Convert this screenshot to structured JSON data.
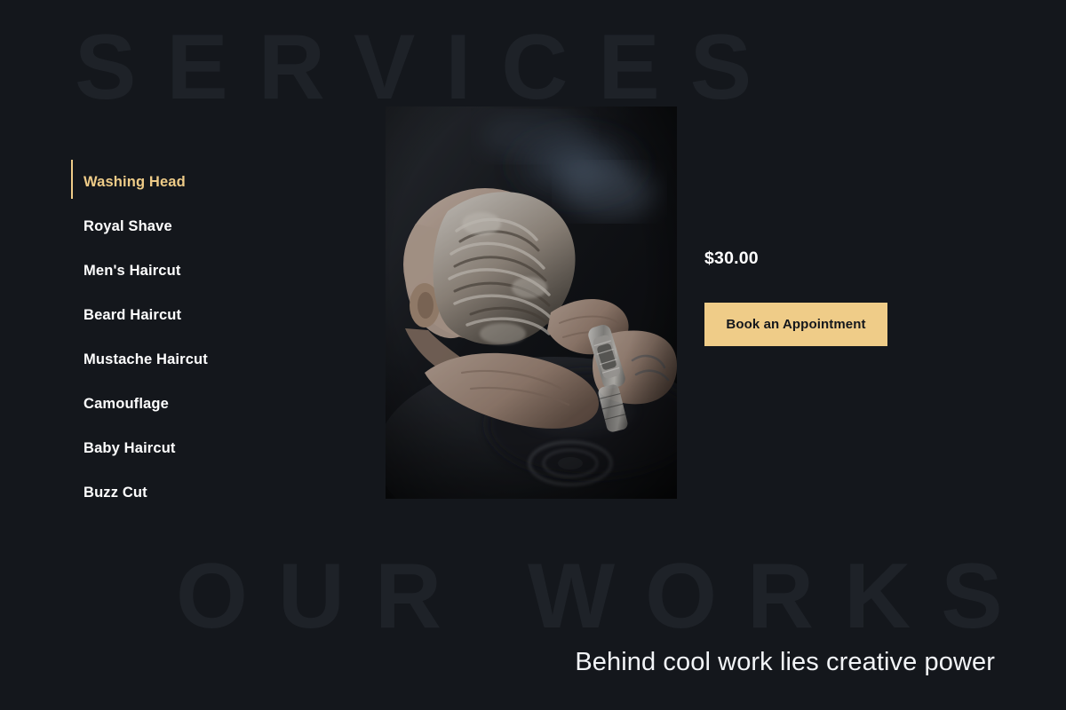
{
  "background": {
    "page_color": "#14171C",
    "watermark_color": "#1E2228",
    "accent_color": "#EFCC88",
    "watermark_top": "SERVICES",
    "watermark_bottom": "OUR WORKS"
  },
  "services": {
    "items": [
      {
        "label": "Washing Head",
        "active": true
      },
      {
        "label": "Royal Shave",
        "active": false
      },
      {
        "label": "Men's Haircut",
        "active": false
      },
      {
        "label": "Beard Haircut",
        "active": false
      },
      {
        "label": "Mustache Haircut",
        "active": false
      },
      {
        "label": "Camouflage",
        "active": false
      },
      {
        "label": "Baby Haircut",
        "active": false
      },
      {
        "label": "Buzz Cut",
        "active": false
      }
    ]
  },
  "feature": {
    "photo_alt": "Barber washing a client's hair at a shampoo basin"
  },
  "detail": {
    "price": "$30.00",
    "book_label": "Book an Appointment"
  },
  "footer": {
    "tagline": "Behind cool work lies creative power"
  }
}
